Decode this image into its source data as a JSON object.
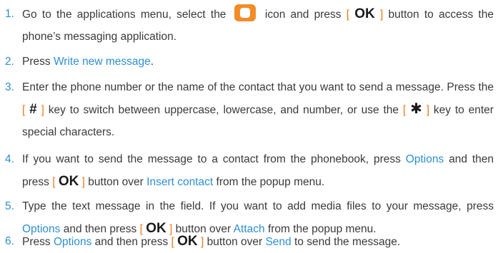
{
  "steps": [
    {
      "num": "1.",
      "t1": "Go to the applications menu, select the",
      "icon": "messaging-app-icon",
      "t2": "icon and press",
      "lb": "[",
      "key": "OK",
      "rb": "]",
      "t3": "button to access the phone’s messaging application."
    },
    {
      "num": "2.",
      "t1": "Press",
      "l1": "Write new message",
      "t2": "."
    },
    {
      "num": "3.",
      "t1": "Enter the phone number or the name of the contact that you want to send a message. Press the",
      "lb1": "[",
      "key1": "#",
      "rb1": "]",
      "t2": "key to switch between uppercase, lowercase, and number, or use the",
      "lb2": "[",
      "key2": "✱",
      "rb2": "]",
      "t3": "key to enter special characters."
    },
    {
      "num": "4.",
      "t1": "If you want to send the message to a contact from the phonebook, press",
      "l1": "Options",
      "t2": "and then press",
      "lb": "[",
      "key": "OK",
      "rb": "]",
      "t3": "button over",
      "l2": "Insert contact",
      "t4": "from the popup menu."
    },
    {
      "num": "5.",
      "t1": "Type the text message in the field. If you want to add media files to your message, press",
      "l1": "Options",
      "t2": "and then press",
      "lb": "[",
      "key": "OK",
      "rb": "]",
      "t3": "button over",
      "l2": "Attach",
      "t4": "from the popup menu."
    },
    {
      "num": "6.",
      "t1": "Press",
      "l1": "Options",
      "t2": "and then press",
      "lb": "[",
      "key": "OK",
      "rb": "]",
      "t3": "button over",
      "l2": "Send",
      "t4": "to send the message."
    }
  ],
  "colors": {
    "text": "#3a3a3a",
    "number": "#2e8fd1",
    "highlight": "#2e8fd1",
    "bracket": "#f07a1a",
    "key": "#1a1a1a",
    "icon": "#f28c28"
  }
}
